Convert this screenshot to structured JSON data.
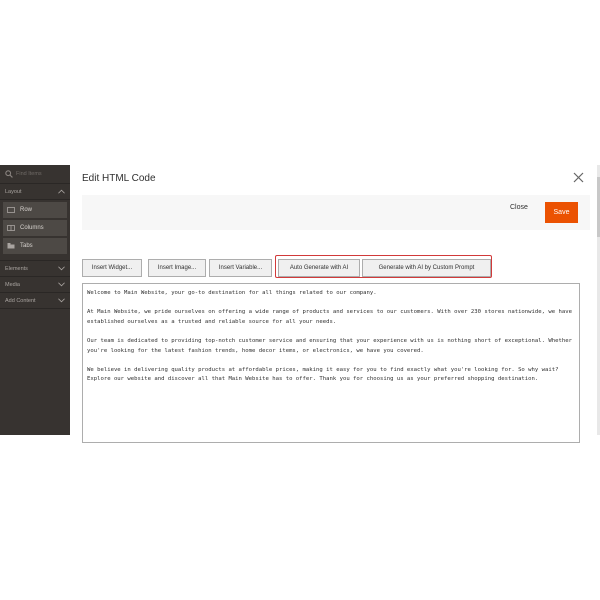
{
  "sidebar": {
    "search_placeholder": "Find Items",
    "sections": [
      {
        "label": "Layout"
      },
      {
        "label": "Elements"
      },
      {
        "label": "Media"
      },
      {
        "label": "Add Content"
      }
    ],
    "layout_items": [
      {
        "label": "Row",
        "icon": "row-icon"
      },
      {
        "label": "Columns",
        "icon": "columns-icon"
      },
      {
        "label": "Tabs",
        "icon": "tabs-icon"
      }
    ]
  },
  "modal": {
    "title": "Edit HTML Code",
    "close_label": "Close",
    "save_label": "Save",
    "toolbar": [
      {
        "label": "Insert Widget..."
      },
      {
        "label": "Insert Image..."
      },
      {
        "label": "Insert Variable..."
      },
      {
        "label": "Auto Generate with AI"
      },
      {
        "label": "Generate with AI by Custom Prompt"
      }
    ],
    "content": [
      "Welcome to Main Website, your go-to destination for all things related to our company.",
      "At Main Website, we pride ourselves on offering a wide range of products and services to our customers. With over 230 stores nationwide, we have established ourselves as a trusted and reliable source for all your needs.",
      "Our team is dedicated to providing top-notch customer service and ensuring that your experience with us is nothing short of exceptional. Whether you're looking for the latest fashion trends, home decor items, or electronics, we have you covered.",
      "We believe in delivering quality products at affordable prices, making it easy for you to find exactly what you're looking for. So why wait? Explore our website and discover all that Main Website has to offer. Thank you for choosing us as your preferred shopping destination."
    ]
  },
  "colors": {
    "accent": "#eb5202",
    "highlight_border": "#d13a3a",
    "sidebar_bg": "#373330"
  }
}
